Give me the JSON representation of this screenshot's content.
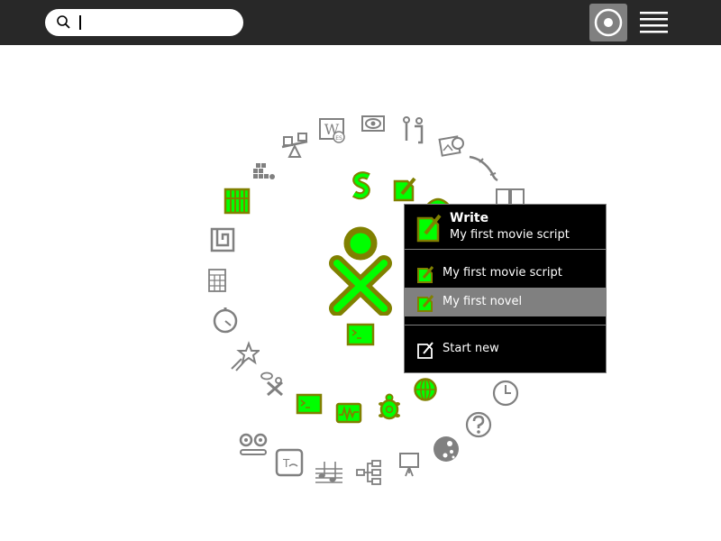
{
  "toolbar": {
    "search_value": "",
    "icons": [
      "search-icon",
      "home-view-icon",
      "list-view-icon"
    ]
  },
  "ring": {
    "icons": [
      "seesaw-icon",
      "wikipedia-icon",
      "eye-icon",
      "people-icon",
      "photo-icon",
      "dolphin-icon",
      "book-icon",
      "blocks-icon",
      "abacus-icon",
      "maze-icon",
      "calculator-icon",
      "stopwatch-icon",
      "star-icon",
      "scratch-icon",
      "terminal-icon",
      "measure-icon",
      "turtle-icon",
      "browse-globe-icon",
      "clock-icon",
      "help-icon",
      "moon-icon",
      "record-icon",
      "typing-icon",
      "music-icon",
      "mind-map-icon",
      "presentation-icon",
      "speak-s-icon",
      "write-icon",
      "xo-buddy-icon"
    ]
  },
  "palette": {
    "title": "Write",
    "subtitle": "My first movie script",
    "items": [
      {
        "label": "My first movie script",
        "selected": false
      },
      {
        "label": "My first novel",
        "selected": true
      }
    ],
    "start_new": "Start new"
  },
  "colors": {
    "topbar": "#282828",
    "fill_green": "#00ff00",
    "stroke_olive": "#808000",
    "palette_bg": "#000000",
    "highlight": "#808080"
  }
}
